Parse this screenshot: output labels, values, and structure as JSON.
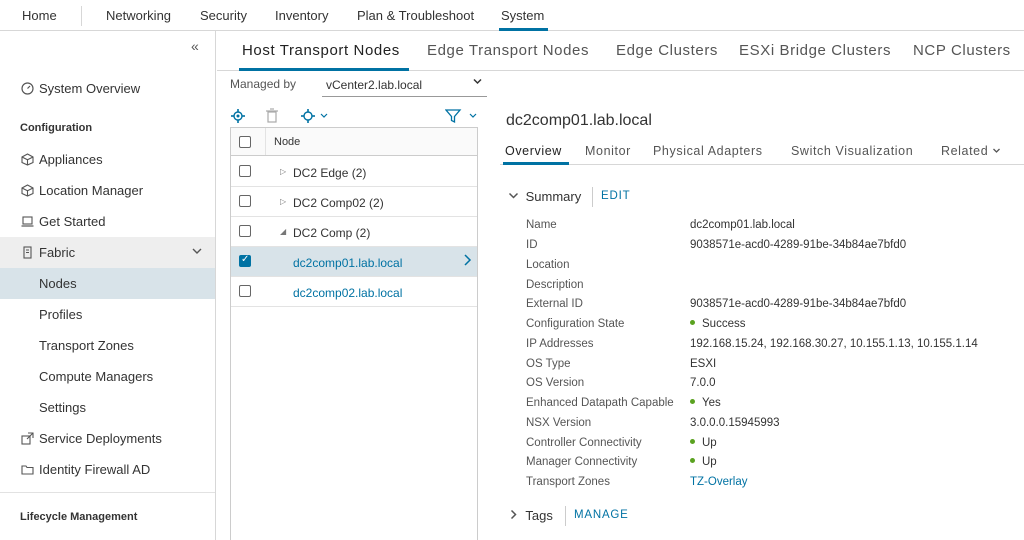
{
  "nav": {
    "items": [
      "Home",
      "Networking",
      "Security",
      "Inventory",
      "Plan & Troubleshoot",
      "System"
    ],
    "active": "System"
  },
  "sidebar": {
    "collapse_icon": "«",
    "system_overview": "System Overview",
    "configuration": "Configuration",
    "appliances": "Appliances",
    "location_manager": "Location Manager",
    "get_started": "Get Started",
    "fabric": "Fabric",
    "nodes": "Nodes",
    "profiles": "Profiles",
    "transport_zones": "Transport Zones",
    "compute_managers": "Compute Managers",
    "settings": "Settings",
    "service_deployments": "Service Deployments",
    "identity_firewall_ad": "Identity Firewall AD",
    "lifecycle_management": "Lifecycle Management"
  },
  "tabs": [
    "Host Transport Nodes",
    "Edge Transport Nodes",
    "Edge Clusters",
    "ESXi Bridge Clusters",
    "NCP Clusters"
  ],
  "active_tab": "Host Transport Nodes",
  "managed_by": {
    "label": "Managed by",
    "value": "vCenter2.lab.local"
  },
  "grid": {
    "header": "Node",
    "rows": [
      {
        "label": "DC2 Edge (2)",
        "checked": false
      },
      {
        "label": "DC2 Comp02 (2)",
        "checked": false
      },
      {
        "label": "DC2 Comp (2)",
        "checked": false
      },
      {
        "label": "dc2comp01.lab.local",
        "checked": true
      },
      {
        "label": "dc2comp02.lab.local",
        "checked": false
      }
    ]
  },
  "detail": {
    "title": "dc2comp01.lab.local",
    "tabs": [
      "Overview",
      "Monitor",
      "Physical Adapters",
      "Switch Visualization",
      "Related"
    ],
    "active_tab": "Overview",
    "summary_label": "Summary",
    "edit_label": "EDIT",
    "tags_label": "Tags",
    "manage_label": "MANAGE",
    "fields": [
      {
        "key": "Name",
        "value": "dc2comp01.lab.local"
      },
      {
        "key": "ID",
        "value": "9038571e-acd0-4289-91be-34b84ae7bfd0"
      },
      {
        "key": "Location",
        "value": ""
      },
      {
        "key": "Description",
        "value": ""
      },
      {
        "key": "External ID",
        "value": "9038571e-acd0-4289-91be-34b84ae7bfd0"
      },
      {
        "key": "Configuration State",
        "value": "Success"
      },
      {
        "key": "IP Addresses",
        "value": "192.168.15.24, 192.168.30.27, 10.155.1.13, 10.155.1.14"
      },
      {
        "key": "OS Type",
        "value": "ESXI"
      },
      {
        "key": "OS Version",
        "value": "7.0.0"
      },
      {
        "key": "Enhanced Datapath Capable",
        "value": "Yes"
      },
      {
        "key": "NSX Version",
        "value": "3.0.0.0.15945993"
      },
      {
        "key": "Controller Connectivity",
        "value": "Up"
      },
      {
        "key": "Manager Connectivity",
        "value": "Up"
      },
      {
        "key": "Transport Zones",
        "value": "TZ-Overlay"
      }
    ]
  },
  "colors": {
    "accent": "#0072a3",
    "status_ok": "#5aa220",
    "selected_row": "#d8e3e9"
  }
}
